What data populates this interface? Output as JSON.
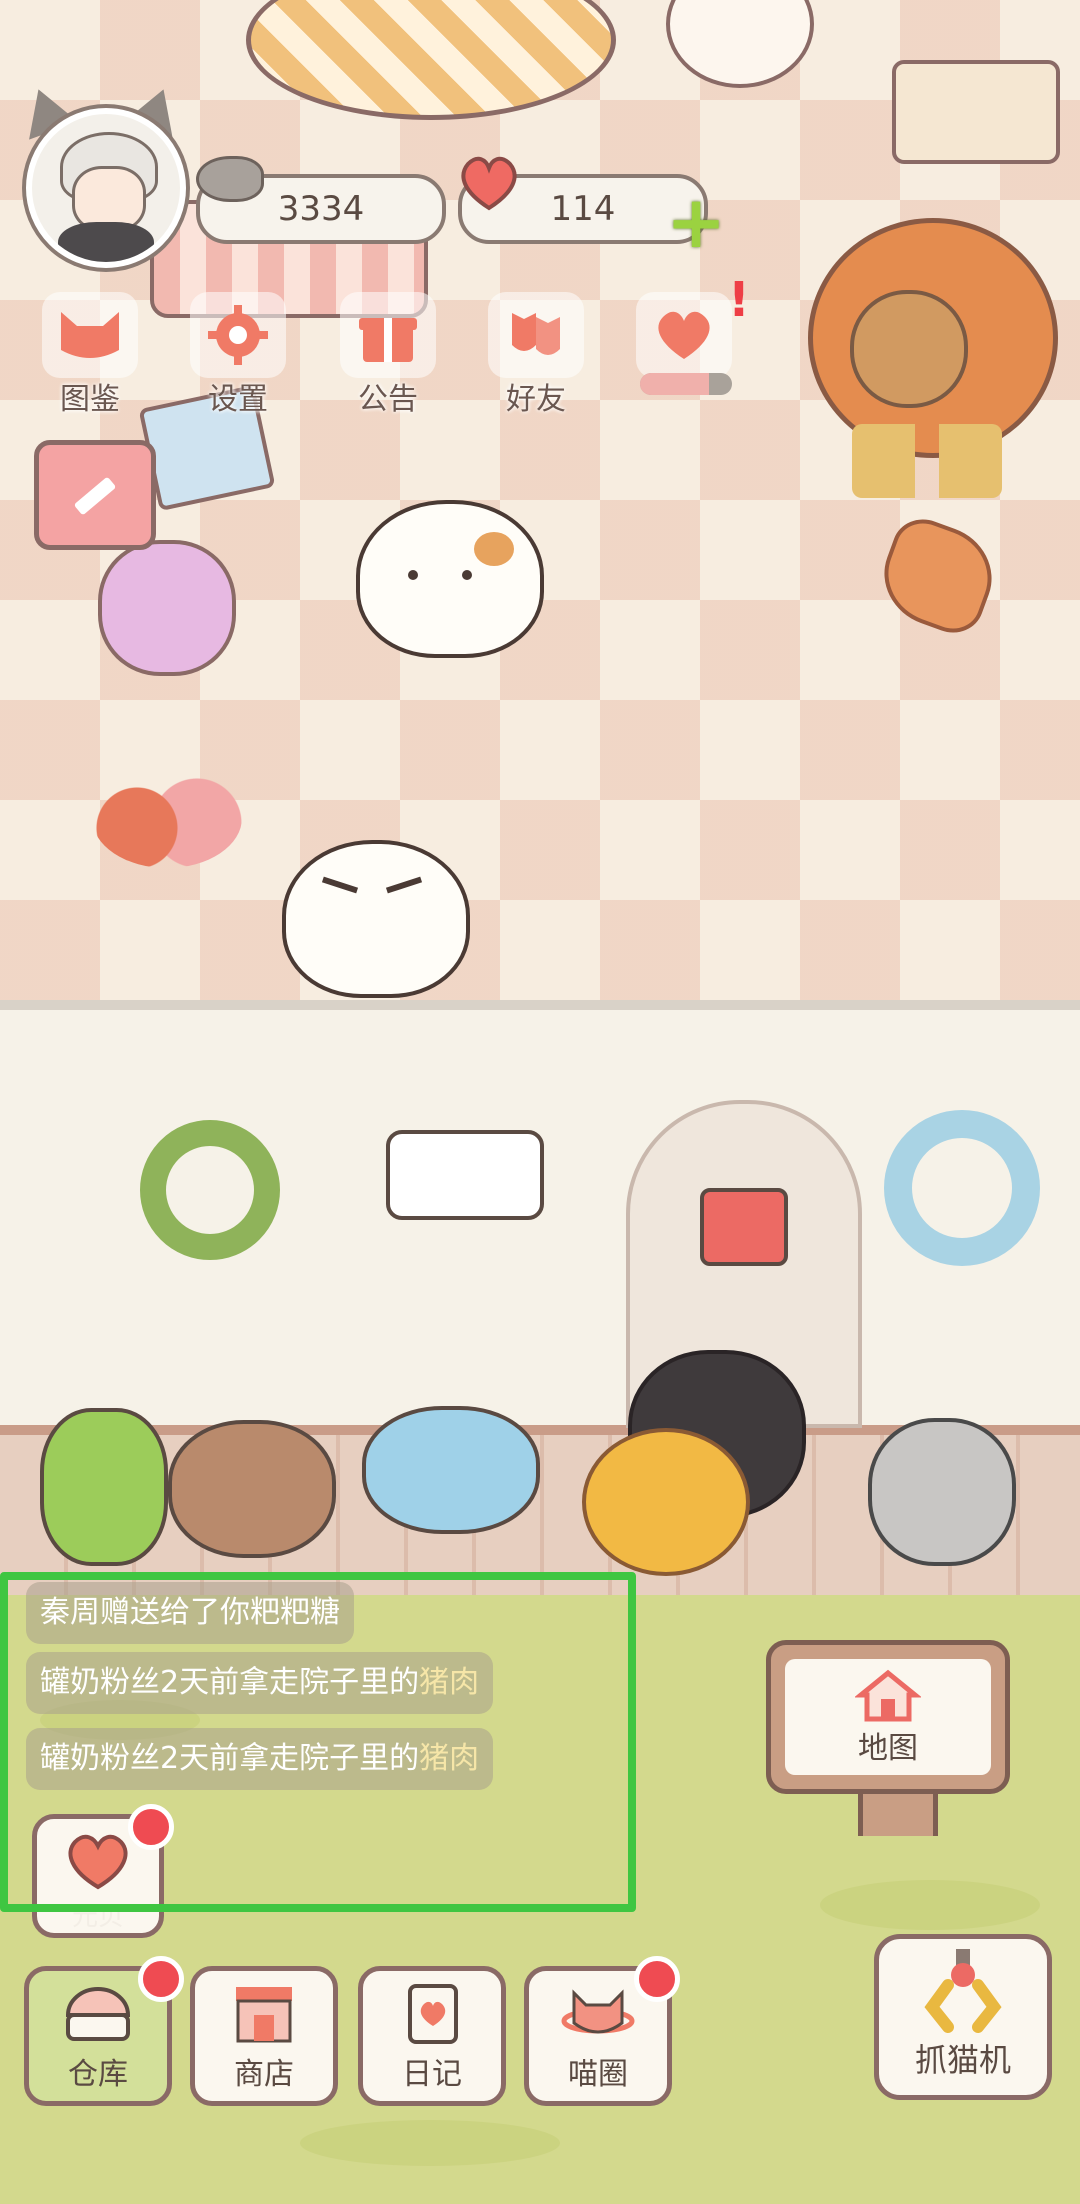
{
  "hud": {
    "fish_count": "3334",
    "heart_count": "114",
    "plus_label": "+",
    "exclamation": "!",
    "friend_progress": 0.75
  },
  "top_menu": [
    {
      "label": "图鉴",
      "icon": "cat-face-icon"
    },
    {
      "label": "设置",
      "icon": "gear-icon"
    },
    {
      "label": "公告",
      "icon": "gift-icon"
    },
    {
      "label": "好友",
      "icon": "friends-icon"
    },
    {
      "label": "",
      "icon": "heart-hands-icon"
    }
  ],
  "messages": [
    {
      "plain": "秦周赠送给了你粑粑糖",
      "highlight": ""
    },
    {
      "plain": "罐奶粉丝2天前拿走院子里的",
      "highlight": "猪肉"
    },
    {
      "plain": "罐奶粉丝2天前拿走院子里的",
      "highlight": "猪肉"
    }
  ],
  "bottom_bar": {
    "warehouse": "仓库",
    "shop": "商店",
    "diary": "日记",
    "meow_circle": "喵圈",
    "claw_machine": "抓猫机",
    "map": "地图",
    "heart_button": "元贝"
  },
  "colors": {
    "highlight_border": "#3fc641",
    "badge": "#ef4b52",
    "grass": "#d3d98d"
  }
}
